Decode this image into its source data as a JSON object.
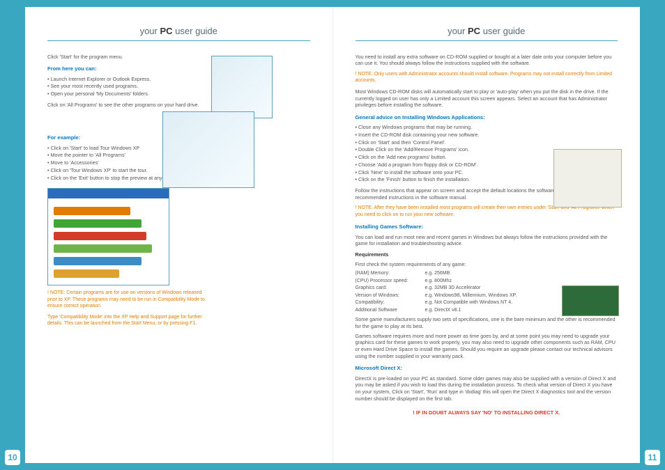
{
  "header": {
    "title_pre": "your",
    "title_bold": "PC",
    "title_post": "user guide"
  },
  "left": {
    "p_start": "Click 'Start' for the program menu.",
    "h_fromhere": "From here you can:",
    "fromhere_items": [
      "Launch Internet Explorer or Outlook Express.",
      "See your most recently used programs.",
      "Open your personal 'My Documents' folders."
    ],
    "p_allprograms": "Click on 'All Programs' to see the other programs on your hard drive.",
    "h_forexample": "For example:",
    "forexample_items": [
      "Click on 'Start' to load Tour Windows XP",
      "Move the pointer to 'All Programs'",
      "Move to 'Accessories'",
      "Click on 'Tour Windows XP' to start the tour.",
      "Click on the 'Exit' button to stop the preview at any time."
    ],
    "note1": "! NOTE: Certain programs are for use on versions of Windows released prior to XP. These programs may need to be run in Compatibility Mode to ensure correct operation.",
    "note2": "Type 'Compatibility Mode' into the XP Help and Support page for further details. This can be launched from the Start Menu, or by pressing F1.",
    "page_num": "10"
  },
  "right": {
    "p_intro": "You need to install any extra software on CD-ROM supplied or bought at a later date onto your computer before you can use it. You should always follow the instructions supplied with the software.",
    "note_admin": "! NOTE: Only users with Administrator accounts should install software. Programs may not install correctly from Limited accounts.",
    "p_autoplay": "Most Windows CD-ROM disks will automatically start to play or 'auto-play' when you put the disk in the drive. If the currently logged on user has only a Limited account this screen appears. Select an account that has Administrator privileges before installing the software.",
    "h_general": "General advice on Installing Windows Applications:",
    "general_items": [
      "Close any Windows programs that may be running.",
      "Insert the CD-ROM disk containing your new software.",
      "Click on 'Start' and then 'Control Panel'.",
      "Double Click on the 'Add/Remove Programs' icon.",
      "Click on the 'Add new programs' button.",
      "Choose 'Add a program from floppy disk or CD-ROM'.",
      "Click 'Next' to install the software onto your PC.",
      "Click on the 'Finish' button to finish the installation."
    ],
    "p_follow": "Follow the instructions that appear on screen and accept the default locations the software suggests, or follow the recommended instructions in the software manual.",
    "note_entries": "! NOTE: After they have been installed most programs will create their own entries under 'Start' and 'All Programs' which you need to click on to run your new software.",
    "h_games": "Installing Games Software:",
    "p_games1": "You can load and run most new and recent games in Windows but always follow the instructions provided with the game for installation and troubleshooting advice.",
    "h_req": "Requirements",
    "p_reqcheck": "First check the system requirements of any game:",
    "req_rows": [
      [
        "(RAM) Memory:",
        "e.g. 256MB"
      ],
      [
        "(CPU) Processor speed:",
        "e.g. 800Mhz"
      ],
      [
        "Graphics card:",
        "e.g. 32MB 3D Accelerator"
      ],
      [
        "Version of Windows:",
        "e.g. Windows98, Millennium, Windows XP."
      ],
      [
        "Compatibility:",
        "e.g. Not Compatible with Windows NT 4."
      ],
      [
        "Additional Software",
        "e.g. DirectX v8.1"
      ]
    ],
    "p_twosets": "Some game manufacturers supply two sets of specifications, one is the bare minimum and the other is recommended for the game to play at its best.",
    "p_upgrade": "Games software requires more and more power as time goes by, and at some point you may need to upgrade your graphics card for these games to work properly, you may also need to upgrade other components such as RAM, CPU or even Hard Drive Space to install the games. Should you require an upgrade please contact our technical advisors using the number supplied in your warranty pack.",
    "h_directx": "Microsoft Direct X:",
    "p_directx": "DirectX is pre-loaded on your PC as standard. Some older games may also be supplied with a version of Direct X and you may be asked if you wish to load this during the installation process. To check what version of Direct X you have on your system, Click on 'Start', 'Run' and type in 'dxdiag' this will open the Direct X diagnostics tool and the version number should be displayed on the first tab.",
    "footer_red": "! IF IN DOUBT ALWAYS SAY 'NO' TO INSTALLING DIRECT X.",
    "page_num": "11"
  }
}
